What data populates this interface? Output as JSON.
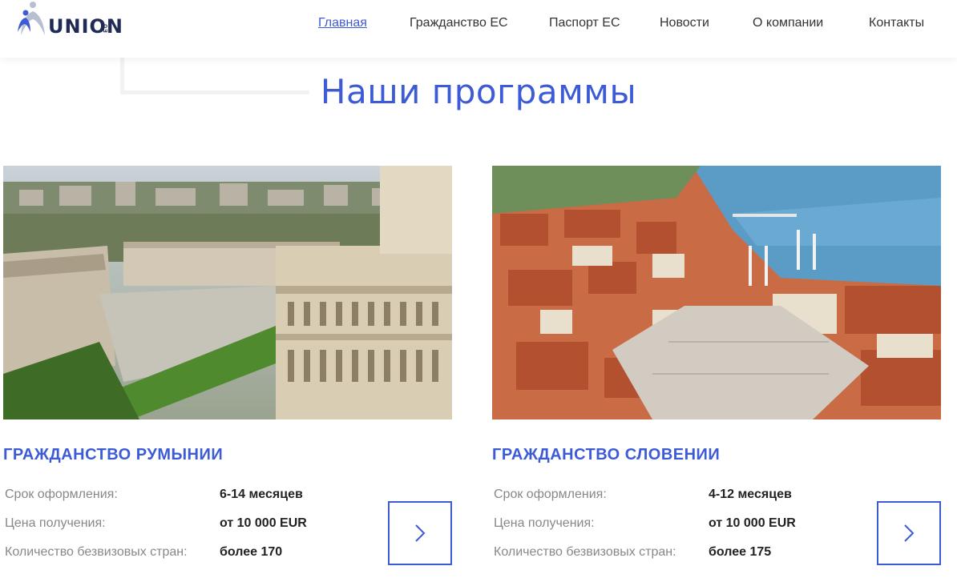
{
  "header": {
    "logo": {
      "text": "UNION",
      "sub": "EU"
    },
    "nav": [
      {
        "label": "Главная",
        "active": true
      },
      {
        "label": "Гражданство ЕС",
        "active": false
      },
      {
        "label": "Паспорт ЕС",
        "active": false
      },
      {
        "label": "Новости",
        "active": false
      },
      {
        "label": "О компании",
        "active": false
      },
      {
        "label": "Контакты",
        "active": false
      }
    ]
  },
  "main": {
    "title": "Наши программы",
    "programs": [
      {
        "title": "ГРАЖДАНСТВО РУМЫНИИ",
        "image": "bucharest-city-aerial-photo",
        "rows": [
          {
            "label": "Срок оформления:",
            "value": "6-14 месяцев"
          },
          {
            "label": "Цена получения:",
            "value": "от 10 000 EUR"
          },
          {
            "label": "Количество безвизовых стран:",
            "value": "более 170"
          }
        ],
        "button_icon": "chevron-right-icon"
      },
      {
        "title": "ГРАЖДАНСТВО СЛОВЕНИИ",
        "image": "piran-coastal-town-aerial-photo",
        "rows": [
          {
            "label": "Срок оформления:",
            "value": "4-12 месяцев"
          },
          {
            "label": "Цена получения:",
            "value": "от 10 000 EUR"
          },
          {
            "label": "Количество безвизовых стран:",
            "value": "более 175"
          }
        ],
        "button_icon": "chevron-right-icon"
      }
    ]
  },
  "colors": {
    "accent": "#3e5bd6",
    "logo": "#1f2a55",
    "muted": "#888888"
  }
}
